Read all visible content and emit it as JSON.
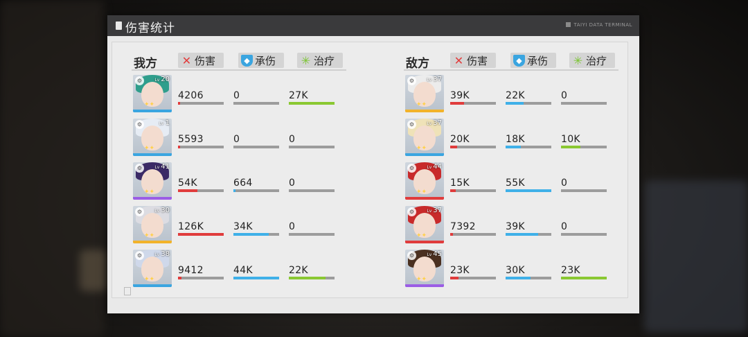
{
  "window": {
    "title": "伤害统计",
    "terminal_label": "TAIYI DATA TERMINAL"
  },
  "legend": {
    "damage": "伤害",
    "taken": "承伤",
    "heal": "治疗"
  },
  "teams": [
    {
      "name": "我方",
      "members": [
        {
          "level": "20",
          "class_icon": "cog-icon",
          "rarity_color": "#3aa5e0",
          "hair": "#2f9e8c",
          "damage": "4206",
          "taken": "0",
          "heal": "27K",
          "damage_frac": 0.04,
          "taken_frac": 0.0,
          "heal_frac": 1.0
        },
        {
          "level": "1",
          "class_icon": "shield-icon",
          "rarity_color": "#3aa5e0",
          "hair": "#e6ecf4",
          "damage": "5593",
          "taken": "0",
          "heal": "0",
          "damage_frac": 0.05,
          "taken_frac": 0.0,
          "heal_frac": 0.0
        },
        {
          "level": "41",
          "class_icon": "cog-icon",
          "rarity_color": "#9b5de5",
          "hair": "#3b2a66",
          "damage": "54K",
          "taken": "664",
          "heal": "0",
          "damage_frac": 0.43,
          "taken_frac": 0.02,
          "heal_frac": 0.0
        },
        {
          "level": "30",
          "class_icon": "cog-icon",
          "rarity_color": "#f2b32a",
          "hair": "#dcdce2",
          "damage": "126K",
          "taken": "34K",
          "heal": "0",
          "damage_frac": 1.0,
          "taken_frac": 0.77,
          "heal_frac": 0.0
        },
        {
          "level": "38",
          "class_icon": "shield-icon",
          "rarity_color": "#3aa5e0",
          "hair": "#cfd8ea",
          "damage": "9412",
          "taken": "44K",
          "heal": "22K",
          "damage_frac": 0.07,
          "taken_frac": 1.0,
          "heal_frac": 0.81
        }
      ]
    },
    {
      "name": "敌方",
      "members": [
        {
          "level": "37",
          "class_icon": "tower-icon",
          "rarity_color": "#f2b32a",
          "hair": "#ececec",
          "damage": "39K",
          "taken": "22K",
          "heal": "0",
          "damage_frac": 0.3,
          "taken_frac": 0.4,
          "heal_frac": 0.0
        },
        {
          "level": "37",
          "class_icon": "clock-icon",
          "rarity_color": "#3aa5e0",
          "hair": "#efe2b8",
          "damage": "20K",
          "taken": "18K",
          "heal": "10K",
          "damage_frac": 0.15,
          "taken_frac": 0.33,
          "heal_frac": 0.43
        },
        {
          "level": "44",
          "class_icon": "tower-icon",
          "rarity_color": "#e03c3c",
          "hair": "#c82a2a",
          "damage": "15K",
          "taken": "55K",
          "heal": "0",
          "damage_frac": 0.12,
          "taken_frac": 1.0,
          "heal_frac": 0.0
        },
        {
          "level": "37",
          "class_icon": "tower-icon",
          "rarity_color": "#e03c3c",
          "hair": "#c82a2a",
          "damage": "7392",
          "taken": "39K",
          "heal": "0",
          "damage_frac": 0.06,
          "taken_frac": 0.71,
          "heal_frac": 0.0
        },
        {
          "level": "45",
          "class_icon": "clock-icon",
          "rarity_color": "#9b5de5",
          "hair": "#4a3020",
          "damage": "23K",
          "taken": "30K",
          "heal": "23K",
          "damage_frac": 0.18,
          "taken_frac": 0.55,
          "heal_frac": 1.0
        }
      ]
    }
  ],
  "colors": {
    "damage": "#e03c3c",
    "taken": "#3fb0e8",
    "heal": "#8ac832"
  }
}
